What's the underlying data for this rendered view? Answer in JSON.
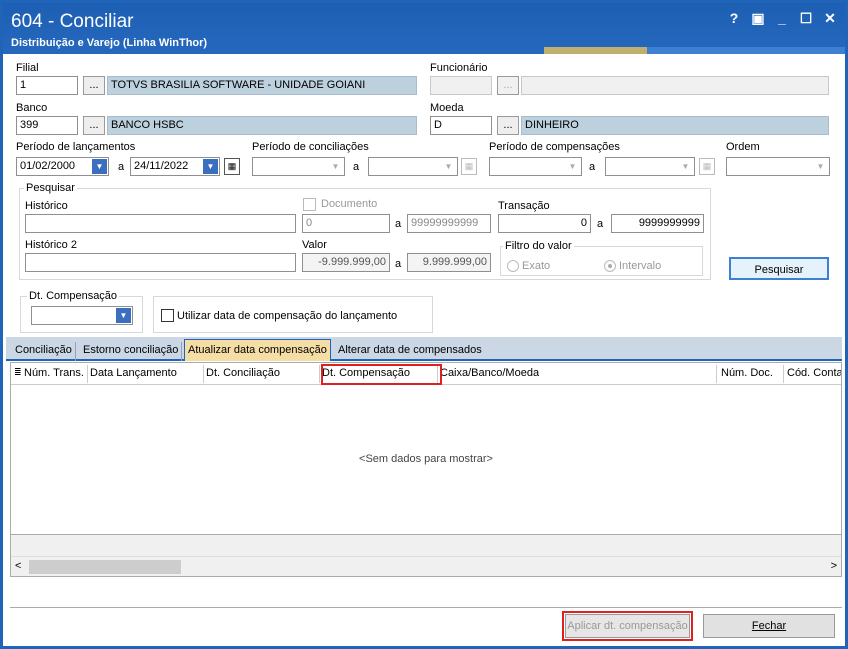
{
  "window": {
    "title": "604 - Conciliar",
    "subtitle": "Distribuição e Varejo (Linha WinThor)",
    "controls": [
      "?",
      "▣",
      "_",
      "☐",
      "✕"
    ]
  },
  "form": {
    "filial": {
      "label": "Filial",
      "code": "1",
      "button": "...",
      "name": "TOTVS BRASILIA SOFTWARE - UNIDADE GOIANI"
    },
    "funcionario": {
      "label": "Funcionário",
      "code": "",
      "button": "...",
      "name": ""
    },
    "banco": {
      "label": "Banco",
      "code": "399",
      "button": "...",
      "name": "BANCO HSBC"
    },
    "moeda": {
      "label": "Moeda",
      "code": "D",
      "button": "...",
      "name": "DINHEIRO"
    },
    "periodo_lancamentos": {
      "label": "Período de lançamentos",
      "from": "01/02/2000",
      "sep": "a",
      "to": "24/11/2022"
    },
    "periodo_conciliacoes": {
      "label": "Período de conciliações",
      "from": "",
      "sep": "a",
      "to": ""
    },
    "periodo_compensacoes": {
      "label": "Período de compensações",
      "from": "",
      "sep": "a",
      "to": ""
    },
    "ordem": {
      "label": "Ordem",
      "value": ""
    },
    "pesquisar_group": {
      "label": "Pesquisar",
      "historico": {
        "label": "Histórico",
        "value": ""
      },
      "documento": {
        "label": "Documento",
        "from": "0",
        "sep": "a",
        "to": "99999999999"
      },
      "transacao": {
        "label": "Transação",
        "from": "0",
        "sep": "a",
        "to": "9999999999"
      },
      "historico2": {
        "label": "Histórico 2",
        "value": ""
      },
      "valor": {
        "label": "Valor",
        "from": "-9.999.999,00",
        "sep": "a",
        "to": "9.999.999,00"
      },
      "filtro_valor": {
        "label": "Filtro do valor",
        "opt1": "Exato",
        "opt2": "Intervalo"
      }
    },
    "pesquisar_button": "Pesquisar",
    "dt_compensacao": {
      "label": "Dt. Compensação",
      "value": ""
    },
    "utilizar_data": "Utilizar data de compensação do lançamento"
  },
  "tabs": [
    {
      "label": "Conciliação"
    },
    {
      "label": "Estorno conciliação"
    },
    {
      "label": "Atualizar data compensação"
    },
    {
      "label": "Alterar data de compensados"
    }
  ],
  "grid": {
    "columns": [
      "Núm. Trans.",
      "Data Lançamento",
      "Dt. Conciliação",
      "Dt. Compensação",
      "Caixa/Banco/Moeda",
      "Núm. Doc.",
      "Cód. Conta"
    ],
    "empty_text": "<Sem dados para mostrar>"
  },
  "buttons": {
    "aplicar": "Aplicar dt. compensação",
    "fechar": "Fechar"
  },
  "colors": {
    "title_bar": "#1d5fb3",
    "active_tab": "#f5dea5",
    "highlight": "#e02020"
  }
}
